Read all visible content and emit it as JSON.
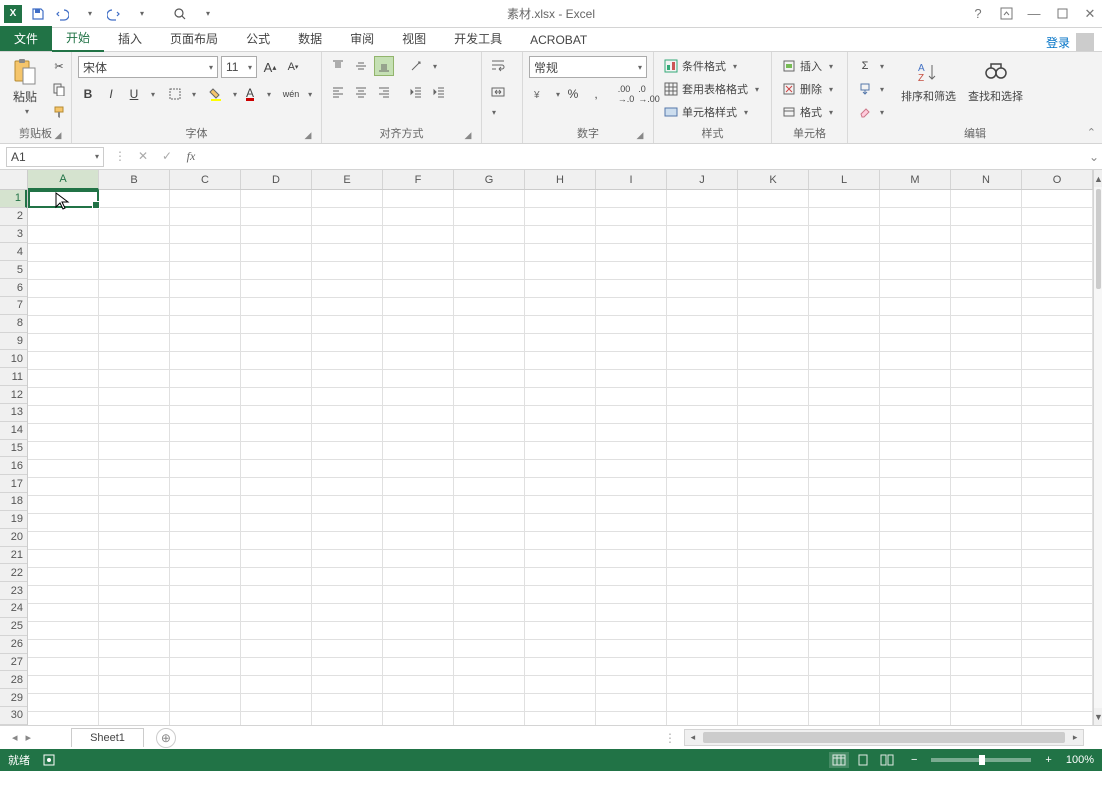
{
  "title": "素材.xlsx - Excel",
  "tabs": {
    "file": "文件",
    "items": [
      "开始",
      "插入",
      "页面布局",
      "公式",
      "数据",
      "审阅",
      "视图",
      "开发工具",
      "ACROBAT"
    ],
    "active_index": 0,
    "login": "登录"
  },
  "ribbon": {
    "clipboard": {
      "paste": "粘贴",
      "label": "剪贴板"
    },
    "font": {
      "name": "宋体",
      "size": "11",
      "label": "字体",
      "bold": "B",
      "italic": "I",
      "underline": "U",
      "phonetic": "wén"
    },
    "align": {
      "label": "对齐方式"
    },
    "number": {
      "format": "常规",
      "label": "数字"
    },
    "styles": {
      "conditional": "条件格式",
      "table": "套用表格格式",
      "cell": "单元格样式",
      "label": "样式"
    },
    "cells": {
      "insert": "插入",
      "delete": "删除",
      "format": "格式",
      "label": "单元格"
    },
    "editing": {
      "sort": "排序和筛选",
      "find": "查找和选择",
      "label": "编辑"
    }
  },
  "namebox": "A1",
  "columns": [
    "A",
    "B",
    "C",
    "D",
    "E",
    "F",
    "G",
    "H",
    "I",
    "J",
    "K",
    "L",
    "M",
    "N",
    "O"
  ],
  "rows": [
    "1",
    "2",
    "3",
    "4",
    "5",
    "6",
    "7",
    "8",
    "9",
    "10",
    "11",
    "12",
    "13",
    "14",
    "15",
    "16",
    "17",
    "18",
    "19",
    "20",
    "21",
    "22",
    "23",
    "24",
    "25",
    "26",
    "27",
    "28",
    "29",
    "30"
  ],
  "sheet": {
    "name": "Sheet1"
  },
  "status": {
    "ready": "就绪",
    "zoom": "100%"
  }
}
